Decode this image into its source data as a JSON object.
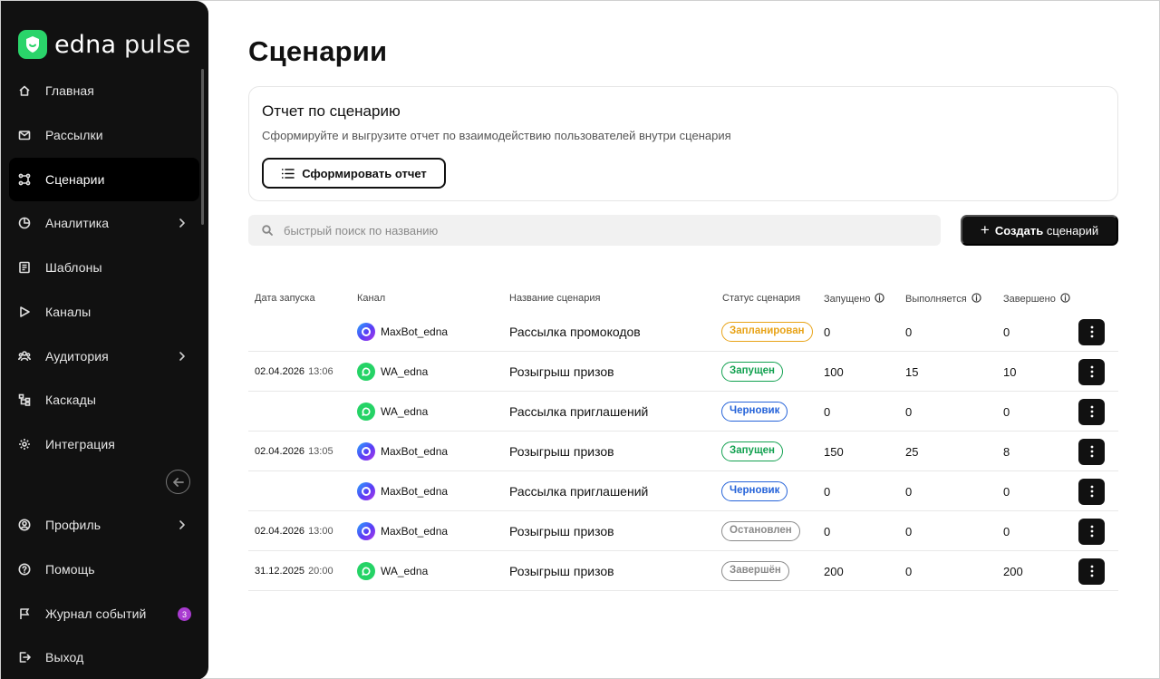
{
  "app": {
    "logo_text_a": "edna",
    "logo_text_b": "pulse"
  },
  "sidebar": {
    "items": [
      {
        "label": "Главная",
        "icon": "home-icon"
      },
      {
        "label": "Рассылки",
        "icon": "mail-icon"
      },
      {
        "label": "Сценарии",
        "icon": "scenario-icon",
        "active": true
      },
      {
        "label": "Аналитика",
        "icon": "analytics-icon",
        "has_submenu": true
      },
      {
        "label": "Шаблоны",
        "icon": "template-icon"
      },
      {
        "label": "Каналы",
        "icon": "channel-icon"
      },
      {
        "label": "Аудитория",
        "icon": "audience-icon",
        "has_submenu": true
      },
      {
        "label": "Каскады",
        "icon": "cascade-icon"
      },
      {
        "label": "Интеграция",
        "icon": "integration-icon"
      }
    ],
    "bottom_items": [
      {
        "label": "Профиль",
        "icon": "profile-icon",
        "has_submenu": true
      },
      {
        "label": "Помощь",
        "icon": "help-icon"
      },
      {
        "label": "Журнал событий",
        "icon": "flag-icon",
        "badge": "3"
      },
      {
        "label": "Выход",
        "icon": "logout-icon"
      }
    ]
  },
  "page": {
    "title": "Сценарии"
  },
  "report": {
    "title": "Отчет по сценарию",
    "description": "Сформируйте и выгрузите отчет по взаимодействию пользователей внутри сценария",
    "button_label": "Сформировать отчет"
  },
  "search": {
    "placeholder": "быстрый поиск по названию"
  },
  "create": {
    "label_bold": "Создать",
    "label_rest": "сценарий"
  },
  "table": {
    "headers": {
      "date": "Дата запуска",
      "channel": "Канал",
      "name": "Название сценария",
      "status": "Статус сценария",
      "launched": "Запущено",
      "running": "Выполняется",
      "finished": "Завершено"
    },
    "rows": [
      {
        "date": "",
        "time": "",
        "channel": "MaxBot_edna",
        "channel_type": "maxbot",
        "name": "Рассылка промокодов",
        "status": "Запланирован",
        "status_color": "#e8a317",
        "launched": "0",
        "running": "0",
        "finished": "0"
      },
      {
        "date": "02.04.2026",
        "time": "13:06",
        "channel": "WA_edna",
        "channel_type": "wa",
        "name": "Розыгрыш призов",
        "status": "Запущен",
        "status_color": "#12a150",
        "launched": "100",
        "running": "15",
        "finished": "10"
      },
      {
        "date": "",
        "time": "",
        "channel": "WA_edna",
        "channel_type": "wa",
        "name": "Рассылка приглашений",
        "status": "Черновик",
        "status_color": "#2563d9",
        "launched": "0",
        "running": "0",
        "finished": "0"
      },
      {
        "date": "02.04.2026",
        "time": "13:05",
        "channel": "MaxBot_edna",
        "channel_type": "maxbot",
        "name": "Розыгрыш призов",
        "status": "Запущен",
        "status_color": "#12a150",
        "launched": "150",
        "running": "25",
        "finished": "8"
      },
      {
        "date": "",
        "time": "",
        "channel": "MaxBot_edna",
        "channel_type": "maxbot",
        "name": "Рассылка приглашений",
        "status": "Черновик",
        "status_color": "#2563d9",
        "launched": "0",
        "running": "0",
        "finished": "0"
      },
      {
        "date": "02.04.2026",
        "time": "13:00",
        "channel": "MaxBot_edna",
        "channel_type": "maxbot",
        "name": "Розыгрыш призов",
        "status": "Остановлен",
        "status_color": "#8a8a8a",
        "launched": "0",
        "running": "0",
        "finished": "0"
      },
      {
        "date": "31.12.2025",
        "time": "20:00",
        "channel": "WA_edna",
        "channel_type": "wa",
        "name": "Розыгрыш призов",
        "status": "Завершён",
        "status_color": "#8a8a8a",
        "launched": "200",
        "running": "0",
        "finished": "200"
      }
    ]
  },
  "colors": {
    "sidebar_bg": "#111111",
    "brand_green": "#2ad46a",
    "badge_purple": "#a93bd0"
  }
}
